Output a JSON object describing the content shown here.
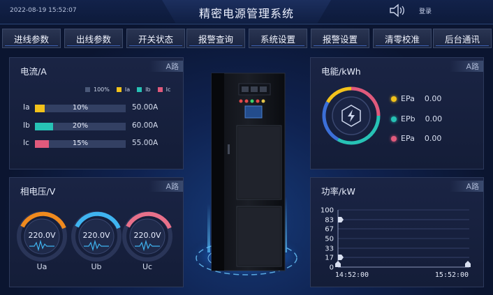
{
  "header": {
    "datetime": "2022-08-19 15:52:07",
    "title": "精密电源管理系统",
    "login": "登录",
    "speaker_icon": "speaker-icon"
  },
  "menu": [
    "进线参数",
    "出线参数",
    "开关状态",
    "报警查询",
    "系统设置",
    "报警设置",
    "清零校准",
    "后台通讯"
  ],
  "current": {
    "title": "电流/A",
    "tag": "A路",
    "legend": [
      {
        "label": "100%",
        "color": "#4a5878"
      },
      {
        "label": "Ia",
        "color": "#f2c21b"
      },
      {
        "label": "Ib",
        "color": "#27c2b5"
      },
      {
        "label": "Ic",
        "color": "#e05a7c"
      }
    ],
    "rows": [
      {
        "label": "Ia",
        "percent": 10,
        "percent_label": "10%",
        "value": "50.00A",
        "color": "#f2c21b"
      },
      {
        "label": "Ib",
        "percent": 20,
        "percent_label": "20%",
        "value": "60.00A",
        "color": "#27c2b5"
      },
      {
        "label": "Ic",
        "percent": 15,
        "percent_label": "15%",
        "value": "55.00A",
        "color": "#e05a7c"
      }
    ]
  },
  "voltage": {
    "title": "相电压/V",
    "tag": "A路",
    "gauges": [
      {
        "label": "Ua",
        "value": "220.0V",
        "color": "#f08a1e"
      },
      {
        "label": "Ub",
        "value": "220.0V",
        "color": "#3fb4f0"
      },
      {
        "label": "Uc",
        "value": "220.0V",
        "color": "#e8708a"
      }
    ]
  },
  "energy": {
    "title": "电能/kWh",
    "tag": "A路",
    "items": [
      {
        "label": "EPa",
        "value": "0.00",
        "color": "#f2c21b"
      },
      {
        "label": "EPb",
        "value": "0.00",
        "color": "#27c2b5"
      },
      {
        "label": "EPa",
        "value": "0.00",
        "color": "#e05a7c"
      }
    ],
    "ring_colors": [
      "#f2c21b",
      "#27c2b5",
      "#e05a7c",
      "#3b6fd8"
    ]
  },
  "power": {
    "title": "功率/kW",
    "tag": "A路",
    "chart_data": {
      "type": "line",
      "ylim": [
        0,
        100
      ],
      "y_ticks": [
        100,
        83,
        67,
        50,
        33,
        17,
        0
      ],
      "x_ticks": [
        "14:52:00",
        "15:52:00"
      ],
      "grid": true,
      "series": []
    }
  }
}
